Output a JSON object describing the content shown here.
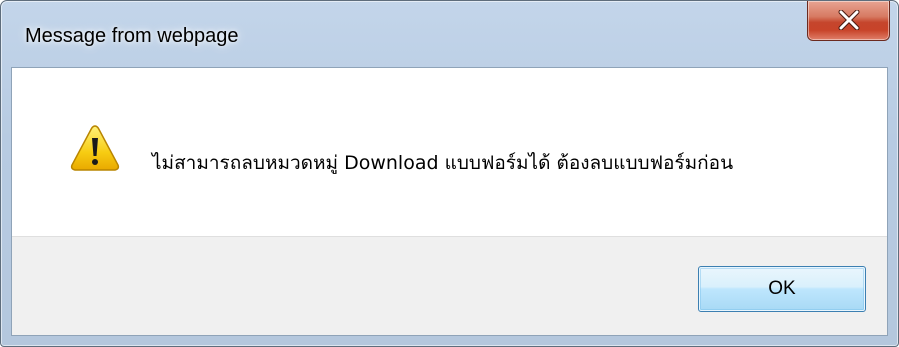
{
  "dialog": {
    "title": "Message from webpage",
    "message": "ไม่สามารถลบหมวดหมู่ Download แบบฟอร์มได้ ต้องลบแบบฟอร์มก่อน",
    "icon": "warning-icon",
    "ok_label": "OK",
    "close_icon": "close-icon"
  },
  "colors": {
    "title_bar": "#b9cde4",
    "close_button": "#c8442a",
    "ok_button_border": "#3c7fb1",
    "footer": "#f0f0f0",
    "warning_fill": "#f5c400"
  }
}
